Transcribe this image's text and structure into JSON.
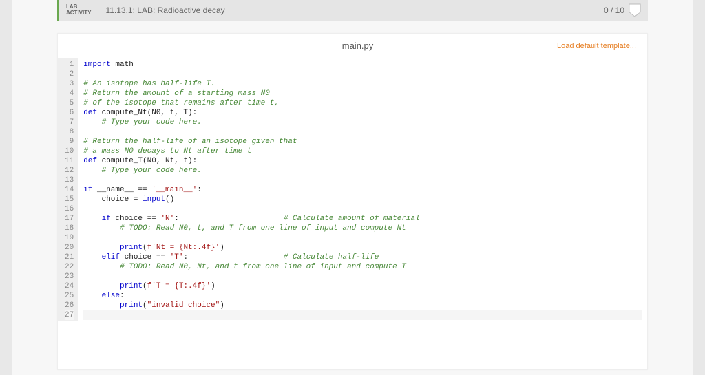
{
  "header": {
    "badge_line1": "LAB",
    "badge_line2": "ACTIVITY",
    "title": "11.13.1: LAB: Radioactive decay",
    "score": "0 / 10"
  },
  "card": {
    "filename": "main.py",
    "load_template": "Load default template..."
  },
  "code": {
    "lines": [
      {
        "n": 1,
        "html": "<span class='kw'>import</span> math"
      },
      {
        "n": 2,
        "html": ""
      },
      {
        "n": 3,
        "html": "<span class='cm'># An isotope has half-life T.</span>"
      },
      {
        "n": 4,
        "html": "<span class='cm'># Return the amount of a starting mass N0</span>"
      },
      {
        "n": 5,
        "html": "<span class='cm'># of the isotope that remains after time t,</span>"
      },
      {
        "n": 6,
        "html": "<span class='kw'>def</span> compute_Nt(N0, t, T):"
      },
      {
        "n": 7,
        "html": "    <span class='cm'># Type your code here.</span>"
      },
      {
        "n": 8,
        "html": ""
      },
      {
        "n": 9,
        "html": "<span class='cm'># Return the half-life of an isotope given that</span>"
      },
      {
        "n": 10,
        "html": "<span class='cm'># a mass N0 decays to Nt after time t</span>"
      },
      {
        "n": 11,
        "html": "<span class='kw'>def</span> compute_T(N0, Nt, t):"
      },
      {
        "n": 12,
        "html": "    <span class='cm'># Type your code here.</span>"
      },
      {
        "n": 13,
        "html": ""
      },
      {
        "n": 14,
        "html": "<span class='kw'>if</span> __name__ == <span class='str'>'__main__'</span>:"
      },
      {
        "n": 15,
        "html": "    choice = <span class='kw'>input</span>()"
      },
      {
        "n": 16,
        "html": ""
      },
      {
        "n": 17,
        "html": "    <span class='kw'>if</span> choice == <span class='str'>'N'</span>:                       <span class='cm'># Calculate amount of material</span>"
      },
      {
        "n": 18,
        "html": "        <span class='cm'># TODO: Read N0, t, and T from one line of input and compute Nt</span>"
      },
      {
        "n": 19,
        "html": ""
      },
      {
        "n": 20,
        "html": "        <span class='kw'>print</span>(<span class='str'>f'Nt = {Nt:.4f}'</span>)"
      },
      {
        "n": 21,
        "html": "    <span class='kw'>elif</span> choice == <span class='str'>'T'</span>:                     <span class='cm'># Calculate half-life</span>"
      },
      {
        "n": 22,
        "html": "        <span class='cm'># TODO: Read N0, Nt, and t from one line of input and compute T</span>"
      },
      {
        "n": 23,
        "html": ""
      },
      {
        "n": 24,
        "html": "        <span class='kw'>print</span>(<span class='str'>f'T = {T:.4f}'</span>)"
      },
      {
        "n": 25,
        "html": "    <span class='kw'>else</span>:"
      },
      {
        "n": 26,
        "html": "        <span class='kw'>print</span>(<span class='str'>\"invalid choice\"</span>)"
      },
      {
        "n": 27,
        "html": "",
        "cursor": true
      }
    ]
  }
}
